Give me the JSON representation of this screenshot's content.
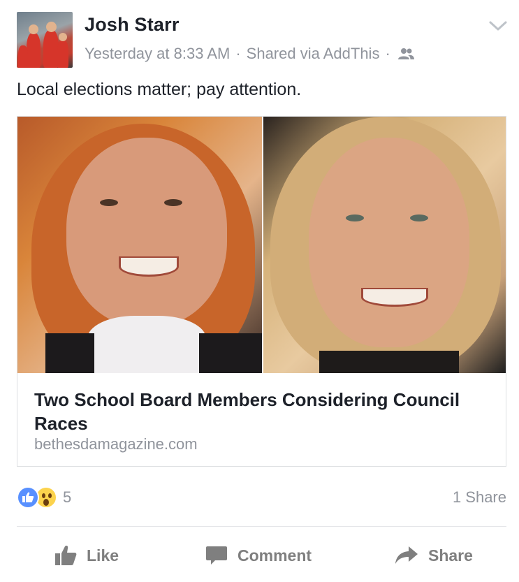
{
  "post": {
    "author": "Josh Starr",
    "timestamp": "Yesterday at 8:33 AM",
    "via": "Shared via AddThis",
    "separator": "·",
    "audience_icon": "friends-icon",
    "text": "Local elections matter; pay attention."
  },
  "link_card": {
    "title": "Two School Board Members Considering Council Races",
    "domain": "bethesdamagazine.com"
  },
  "engagement": {
    "reaction_icons": [
      "like-reaction-icon",
      "wow-reaction-icon"
    ],
    "reaction_count": "5",
    "share_count": "1 Share"
  },
  "actions": {
    "like": "Like",
    "comment": "Comment",
    "share": "Share"
  },
  "colors": {
    "text": "#1d2129",
    "meta": "#90949c",
    "like_blue": "#5890ff",
    "wow_yellow": "#fcd34d",
    "action_gray": "#7f7f7f"
  }
}
